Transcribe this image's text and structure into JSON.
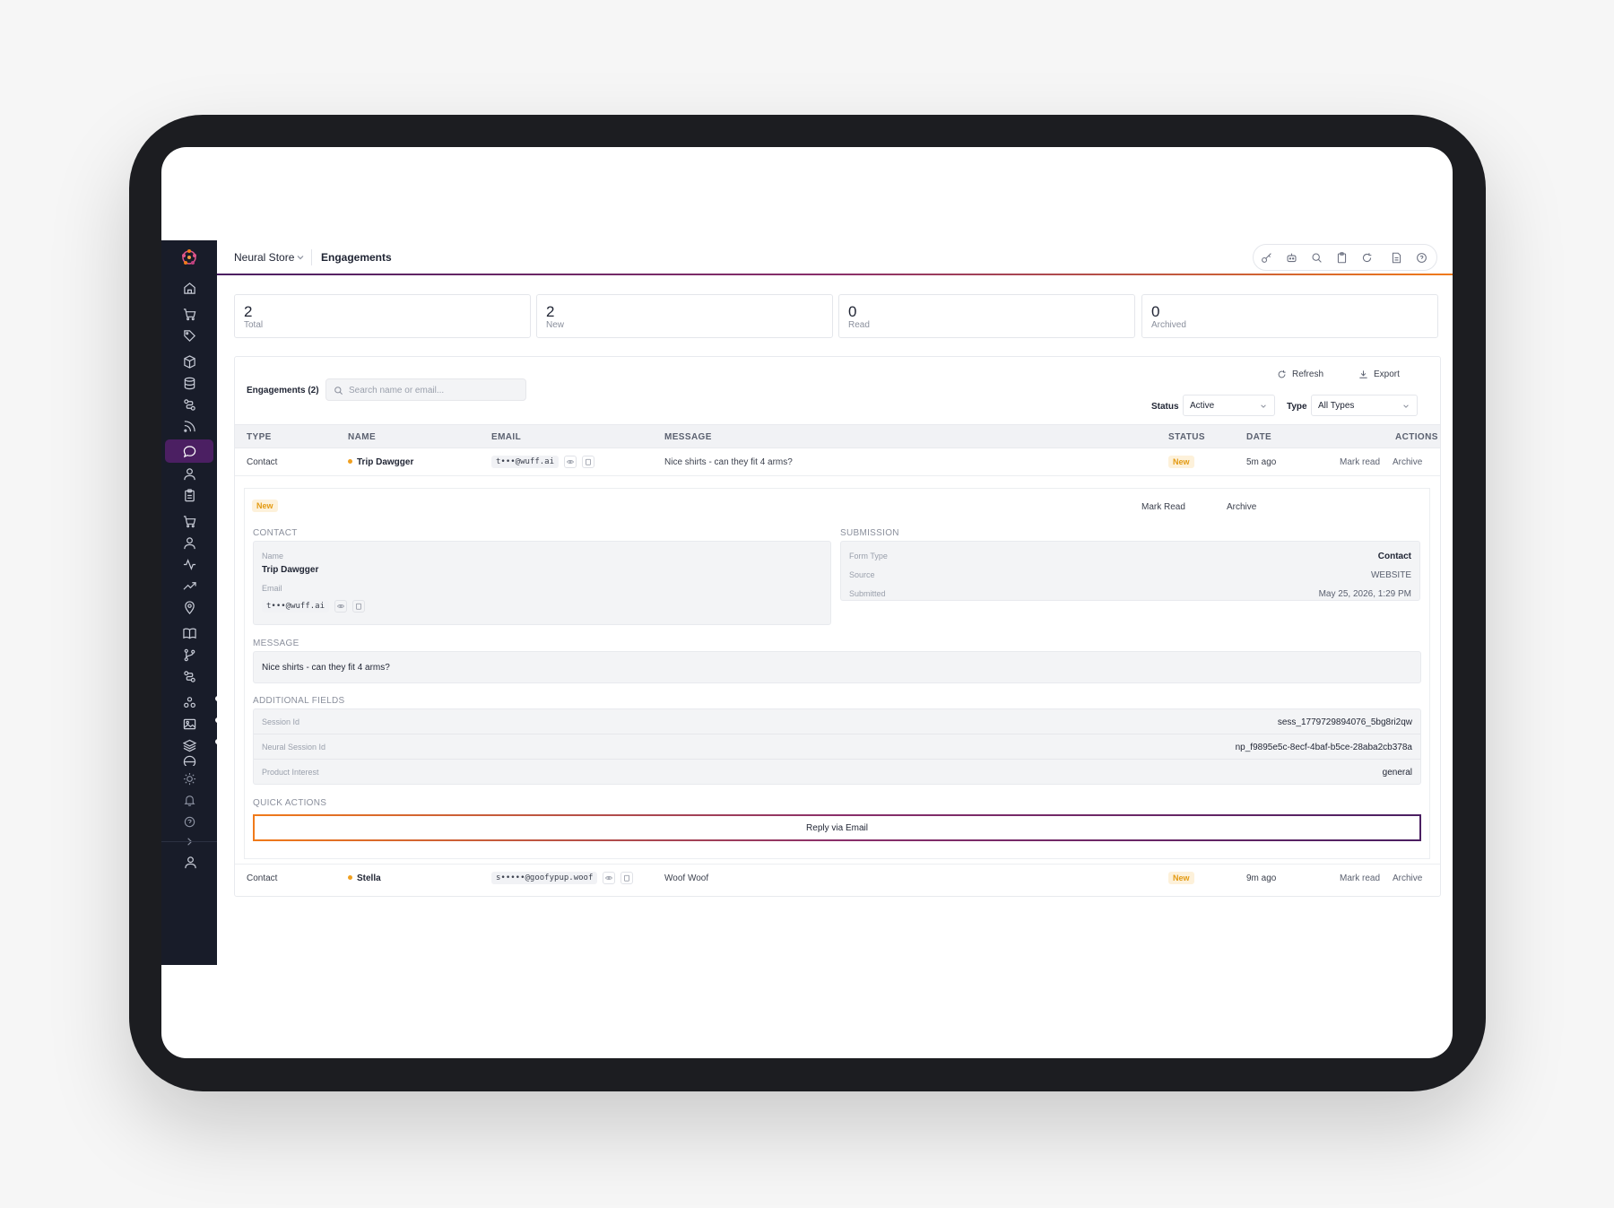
{
  "header": {
    "store_label": "Neural Store",
    "page_title": "Engagements"
  },
  "stats": [
    {
      "value": "2",
      "label": "Total"
    },
    {
      "value": "2",
      "label": "New"
    },
    {
      "value": "0",
      "label": "Read"
    },
    {
      "value": "0",
      "label": "Archived"
    }
  ],
  "panel": {
    "title": "Engagements (2)",
    "search_placeholder": "Search name or email...",
    "refresh_label": "Refresh",
    "export_label": "Export",
    "status_label": "Status",
    "status_value": "Active",
    "type_label": "Type",
    "type_value": "All Types"
  },
  "table": {
    "columns": [
      "TYPE",
      "NAME",
      "EMAIL",
      "MESSAGE",
      "STATUS",
      "DATE",
      "ACTIONS"
    ],
    "rows": [
      {
        "type": "Contact",
        "name": "Trip Dawgger",
        "email": "t•••@wuff.ai",
        "message": "Nice shirts - can they fit 4 arms?",
        "status": "New",
        "date": "5m ago",
        "mark_read": "Mark read",
        "archive": "Archive"
      },
      {
        "type": "Contact",
        "name": "Stella",
        "email": "s•••••@goofypup.woof",
        "message": "Woof Woof",
        "status": "New",
        "date": "9m ago",
        "mark_read": "Mark read",
        "archive": "Archive"
      }
    ]
  },
  "detail": {
    "status": "New",
    "mark_read_label": "Mark Read",
    "archive_label": "Archive",
    "contact_label": "CONTACT",
    "name_key": "Name",
    "name_value": "Trip Dawgger",
    "email_key": "Email",
    "email_value": "t•••@wuff.ai",
    "submission_label": "SUBMISSION",
    "form_type_key": "Form Type",
    "form_type_value": "Contact",
    "source_key": "Source",
    "source_value": "WEBSITE",
    "submitted_key": "Submitted",
    "submitted_value": "May 25, 2026, 1:29 PM",
    "message_label": "MESSAGE",
    "message_value": "Nice shirts - can they fit 4 arms?",
    "additional_label": "ADDITIONAL FIELDS",
    "fields": [
      {
        "key": "Session Id",
        "value": "sess_1779729894076_5bg8ri2qw"
      },
      {
        "key": "Neural Session Id",
        "value": "np_f9895e5c-8ecf-4baf-b5ce-28aba2cb378a"
      },
      {
        "key": "Product Interest",
        "value": "general"
      }
    ],
    "quick_actions_label": "QUICK ACTIONS",
    "reply_label": "Reply via Email"
  },
  "colors": {
    "sidebar_bg": "#181c29",
    "active_nav": "#4b1f62",
    "accent_orange": "#f07a1a",
    "new_badge": "#e39a12"
  }
}
